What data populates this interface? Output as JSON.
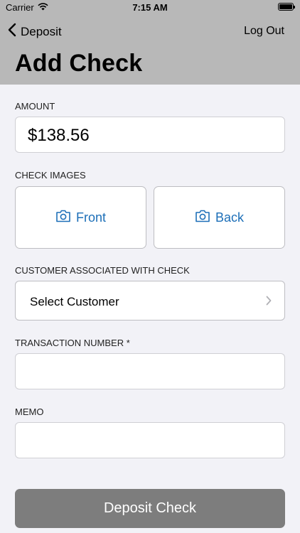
{
  "status_bar": {
    "carrier": "Carrier",
    "time": "7:15 AM"
  },
  "nav": {
    "back_label": "Deposit",
    "logout_label": "Log Out"
  },
  "page": {
    "title": "Add Check"
  },
  "form": {
    "amount": {
      "label": "AMOUNT",
      "value": "$138.56"
    },
    "check_images": {
      "label": "CHECK IMAGES",
      "front_label": "Front",
      "back_label": "Back"
    },
    "customer": {
      "label": "CUSTOMER ASSOCIATED WITH CHECK",
      "value": "Select Customer"
    },
    "transaction_number": {
      "label": "TRANSACTION NUMBER *",
      "value": ""
    },
    "memo": {
      "label": "MEMO",
      "value": ""
    }
  },
  "actions": {
    "deposit_label": "Deposit Check"
  },
  "colors": {
    "accent": "#1d6fb8",
    "header_bg": "#b8b8b8",
    "button_disabled": "#7d7d7d",
    "page_bg": "#f2f2f7"
  },
  "icons": {
    "camera": "camera-icon",
    "chevron": "chevron-right-icon",
    "back": "chevron-left-icon"
  }
}
